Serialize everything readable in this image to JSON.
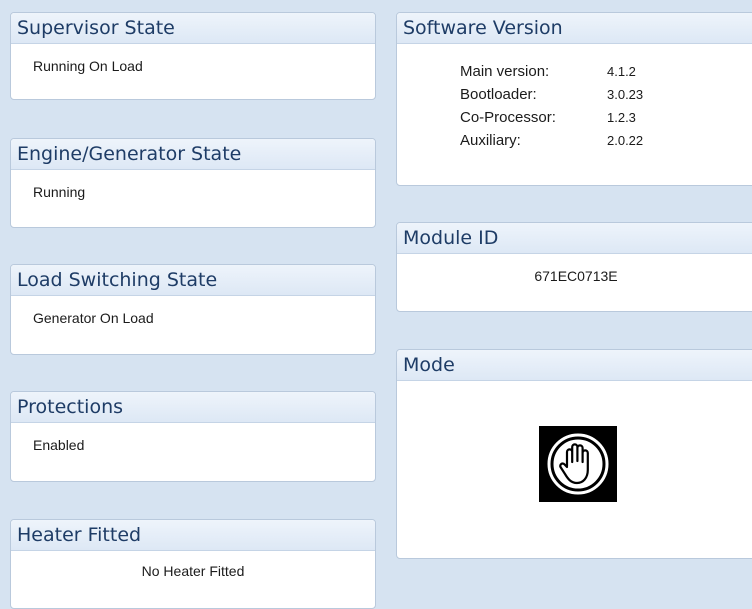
{
  "supervisor_state": {
    "title": "Supervisor State",
    "value": "Running On Load"
  },
  "engine_state": {
    "title": "Engine/Generator State",
    "value": "Running"
  },
  "load_switching": {
    "title": "Load Switching State",
    "value": "Generator On Load"
  },
  "protections": {
    "title": "Protections",
    "value": "Enabled"
  },
  "heater": {
    "title": "Heater Fitted",
    "value": "No Heater Fitted"
  },
  "software_version": {
    "title": "Software Version",
    "rows": [
      {
        "label": "Main version:",
        "value": "4.1.2"
      },
      {
        "label": "Bootloader:",
        "value": "3.0.23"
      },
      {
        "label": "Co-Processor:",
        "value": "1.2.3"
      },
      {
        "label": "Auxiliary:",
        "value": "2.0.22"
      }
    ]
  },
  "module_id": {
    "title": "Module ID",
    "value": "671EC0713E"
  },
  "mode": {
    "title": "Mode",
    "icon": "manual-mode-hand-icon"
  },
  "colors": {
    "background": "#d6e3f1",
    "header_text": "#1e3c66",
    "border": "#b9c9dc"
  }
}
